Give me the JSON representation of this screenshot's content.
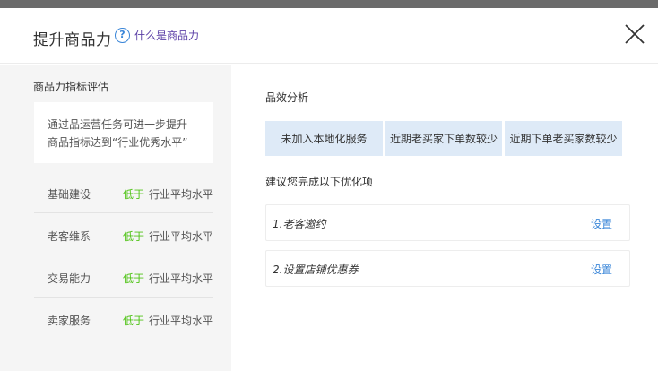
{
  "header": {
    "title": "提升商品力",
    "help_icon_glyph": "?",
    "help_link": "什么是商品力"
  },
  "left_panel": {
    "title": "商品力指标评估",
    "tip_line1": "通过品运营任务可进一步提升",
    "tip_line2": "商品指标达到“行业优秀水平”",
    "metrics": [
      {
        "name": "基础建设",
        "status": "低于",
        "benchmark": "行业平均水平"
      },
      {
        "name": "老客维系",
        "status": "低于",
        "benchmark": "行业平均水平"
      },
      {
        "name": "交易能力",
        "status": "低于",
        "benchmark": "行业平均水平"
      },
      {
        "name": "卖家服务",
        "status": "低于",
        "benchmark": "行业平均水平"
      }
    ]
  },
  "right_panel": {
    "analysis_title": "品效分析",
    "tags": [
      "未加入本地化服务",
      "近期老买家下单数较少",
      "近期下单老买家数较少"
    ],
    "suggest_title": "建议您完成以下优化项",
    "items": [
      {
        "label": "1.老客邀约",
        "action": "设置"
      },
      {
        "label": "2.设置店铺优惠券",
        "action": "设置"
      }
    ]
  },
  "colors": {
    "accent": "#3a86d8",
    "status_green": "#52c41a",
    "tag_bg": "#deeaf7",
    "left_bg": "#f5f5f5"
  },
  "icons": {
    "help": "question-circle-icon",
    "close": "close-x-icon"
  }
}
